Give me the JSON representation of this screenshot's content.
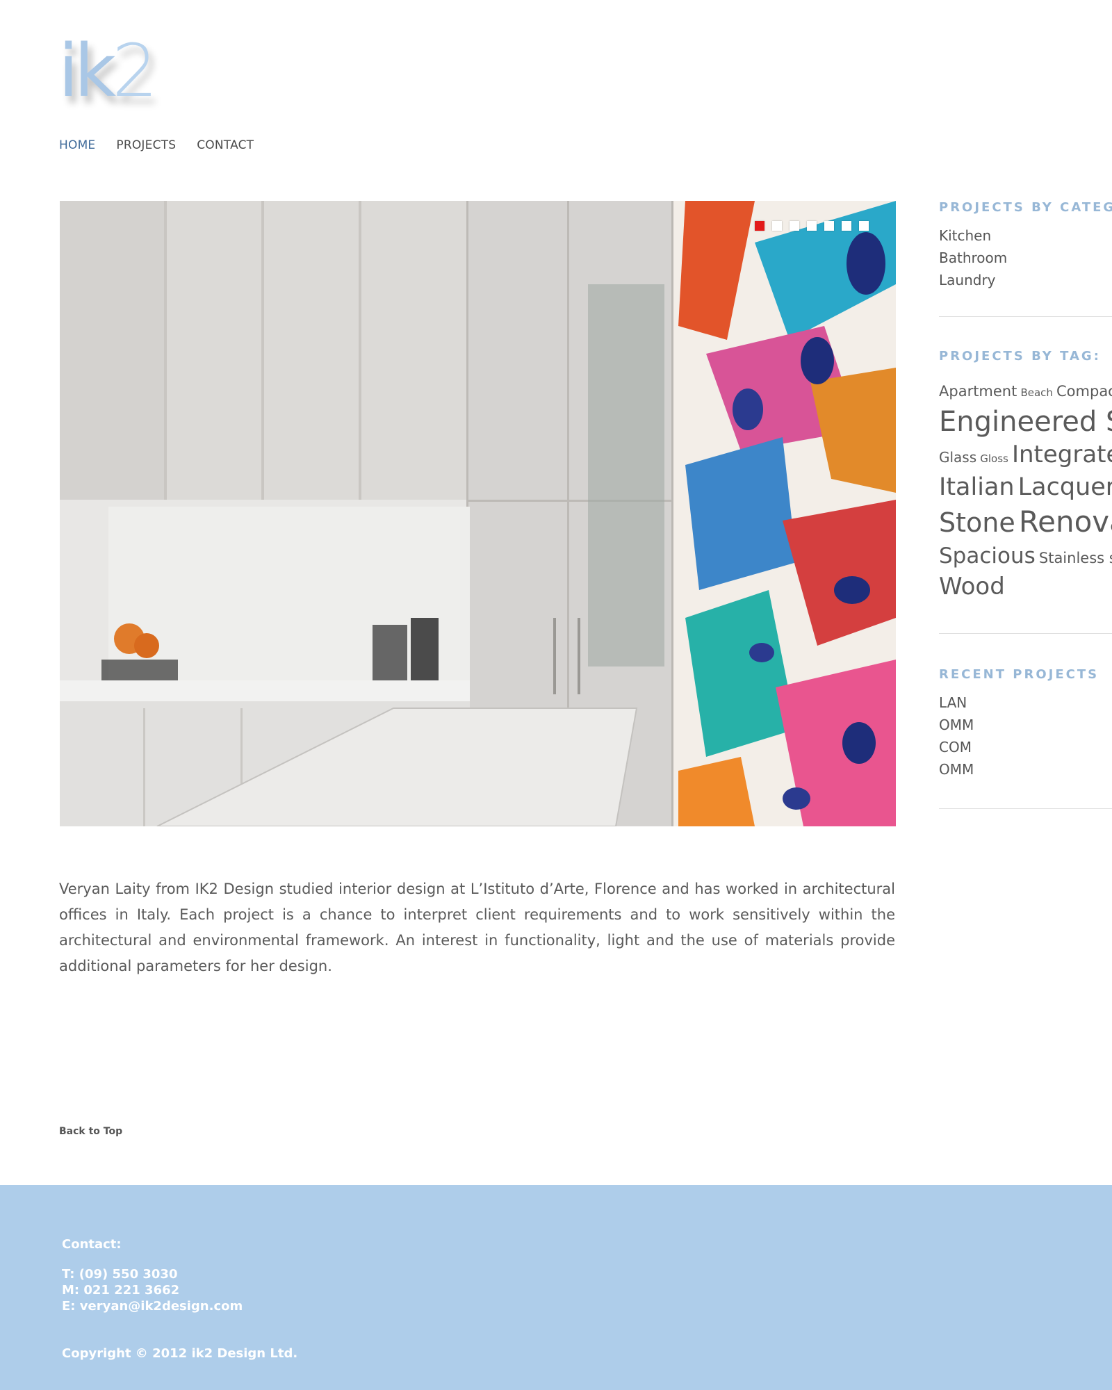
{
  "logo": {
    "text_a": "ik",
    "text_b": "2"
  },
  "nav": {
    "items": [
      {
        "label": "HOME"
      },
      {
        "label": "PROJECTS"
      },
      {
        "label": "CONTACT"
      }
    ]
  },
  "slider": {
    "total": 7,
    "active_index": 0
  },
  "bio": "Veryan Laity from  IK2 Design studied interior design at L’Istituto d’Arte, Florence and has worked in architectural offices in Italy. Each project is a chance to interpret client requirements and to work sensitively within the architectural and environmental framework. An interest in functionality, light and the use of materials provide additional parameters for her design.",
  "back_to_top": "Back to Top",
  "sidebar": {
    "categories": {
      "heading": "PROJECTS BY CATEG",
      "items": [
        "Kitchen",
        "Bathroom",
        "Laundry"
      ]
    },
    "tags": {
      "heading": "PROJECTS BY TAG:",
      "items": [
        {
          "label": "Apartment"
        },
        {
          "label": "Beach"
        },
        {
          "label": "Compac"
        },
        {
          "label": "Engineered St"
        },
        {
          "label": "Glass"
        },
        {
          "label": "Gloss"
        },
        {
          "label": "Integrate"
        },
        {
          "label": "Italian"
        },
        {
          "label": "Lacquer"
        },
        {
          "label": "Stone"
        },
        {
          "label": "Renova"
        },
        {
          "label": "Spacious"
        },
        {
          "label": "Stainless ste"
        },
        {
          "label": "Wood"
        }
      ]
    },
    "recent": {
      "heading": "RECENT PROJECTS",
      "items": [
        "LAN",
        "OMM",
        "COM",
        "OMM"
      ]
    }
  },
  "footer": {
    "contact_label": "Contact:",
    "phone": "T:  (09)  550 3030",
    "mobile": "M:   021 221 3662",
    "email": "E:    veryan@ik2design.com",
    "copyright": "Copyright © 2012 ik2 Design Ltd."
  },
  "colors": {
    "accent": "#3f6a99",
    "sidebar_heading": "#97b7d6",
    "footer_bg": "#aecdea",
    "slider_active": "#e21a1a"
  }
}
